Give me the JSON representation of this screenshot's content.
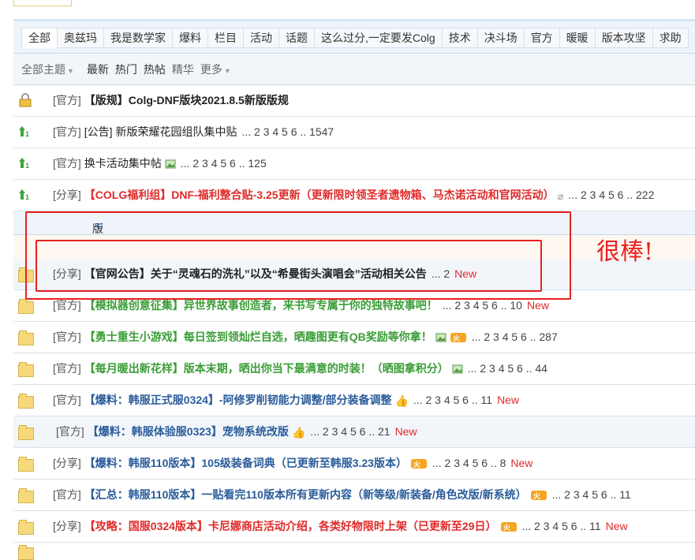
{
  "tabs": [
    "全部",
    "奥兹玛",
    "我是数学家",
    "爆料",
    "栏目",
    "活动",
    "话题",
    "这么过分,一定要发Colg",
    "技术",
    "决斗场",
    "官方",
    "暖暖",
    "版本攻坚",
    "求助"
  ],
  "filter": {
    "all_topics": "全部主题",
    "latest": "最新",
    "hot": "热门",
    "heat": "热帖",
    "digest": "精华",
    "more": "更多"
  },
  "pinned": [
    {
      "cat": "[官方]",
      "title": "【版规】Colg-DNF版块2021.8.5新版版规",
      "pages": "",
      "icon": "lock-icon"
    },
    {
      "cat": "[官方]",
      "title": "[公告] 新版荣耀花园组队集中贴",
      "pages": "... 2  3  4  5  6 .. 1547",
      "icon": "pin-icon"
    },
    {
      "cat": "[官方]",
      "title": "换卡活动集中帖",
      "pages": "... 2  3  4  5  6 .. 125",
      "icon": "pin-icon"
    },
    {
      "cat": "[分享]",
      "title": "【COLG福利组】DNF-福利整合贴-3.25更新（更新限时领圣者遗物箱、马杰诺活动和官网活动）",
      "pages": "... 2  3  4  5  6 .. 222",
      "icon": "pin-icon"
    }
  ],
  "section": {
    "label": "版块主题",
    "refresh_icon": "refresh-icon"
  },
  "annotation": {
    "text": "很棒!"
  },
  "threads": [
    {
      "cat": "[分享]",
      "title": "【官网公告】关于“灵魂石的洗礼”以及“希曼街头演唱会”活动相关公告",
      "pages": "... 2",
      "new": "New",
      "style": "bold"
    },
    {
      "cat": "[官方]",
      "title": "【模拟器创意征集】异世界故事创造者，来书写专属于你的独特故事吧！",
      "pages": "... 2  3  4  5  6 .. 10",
      "new": "New",
      "style": "green"
    },
    {
      "cat": "[官方]",
      "title": "【勇士重生小游戏】每日签到领灿烂自选，晒趣图更有QB奖励等你拿！",
      "pages": "... 2  3  4  5  6 .. 287",
      "new": "",
      "style": "green"
    },
    {
      "cat": "[官方]",
      "title": "【每月暖出新花样】版本末期，晒出你当下最满意的时装！（晒图拿积分）",
      "pages": "... 2  3  4  5  6 .. 44",
      "new": "",
      "style": "green"
    },
    {
      "cat": "[官方]",
      "title": "【爆料：韩服正式服0324】-阿修罗削韧能力调整/部分装备调整",
      "pages": "... 2  3  4  5  6 .. 11",
      "new": "New",
      "style": "blue"
    },
    {
      "cat": "[官方]",
      "title": "【爆料：韩服体验服0323】宠物系统改版",
      "pages": "... 2  3  4  5  6 .. 21",
      "new": "New",
      "style": "blue"
    },
    {
      "cat": "[分享]",
      "title": "【爆料：韩服110版本】105级装备词典（已更新至韩服3.23版本）",
      "pages": "... 2  3  4  5  6 .. 8",
      "new": "New",
      "style": "blue"
    },
    {
      "cat": "[官方]",
      "title": "【汇总：韩服110版本】一贴看完110版本所有更新内容（新等级/新装备/角色改版/新系统）",
      "pages": "... 2  3  4  5  6 .. 11",
      "new": "",
      "style": "blue"
    },
    {
      "cat": "[分享]",
      "title": "【攻略：国服0324版本】卡尼娜商店活动介绍，各类好物限时上架（已更新至29日）",
      "pages": "... 2  3  4  5  6 .. 11",
      "new": "New",
      "style": "red"
    }
  ]
}
